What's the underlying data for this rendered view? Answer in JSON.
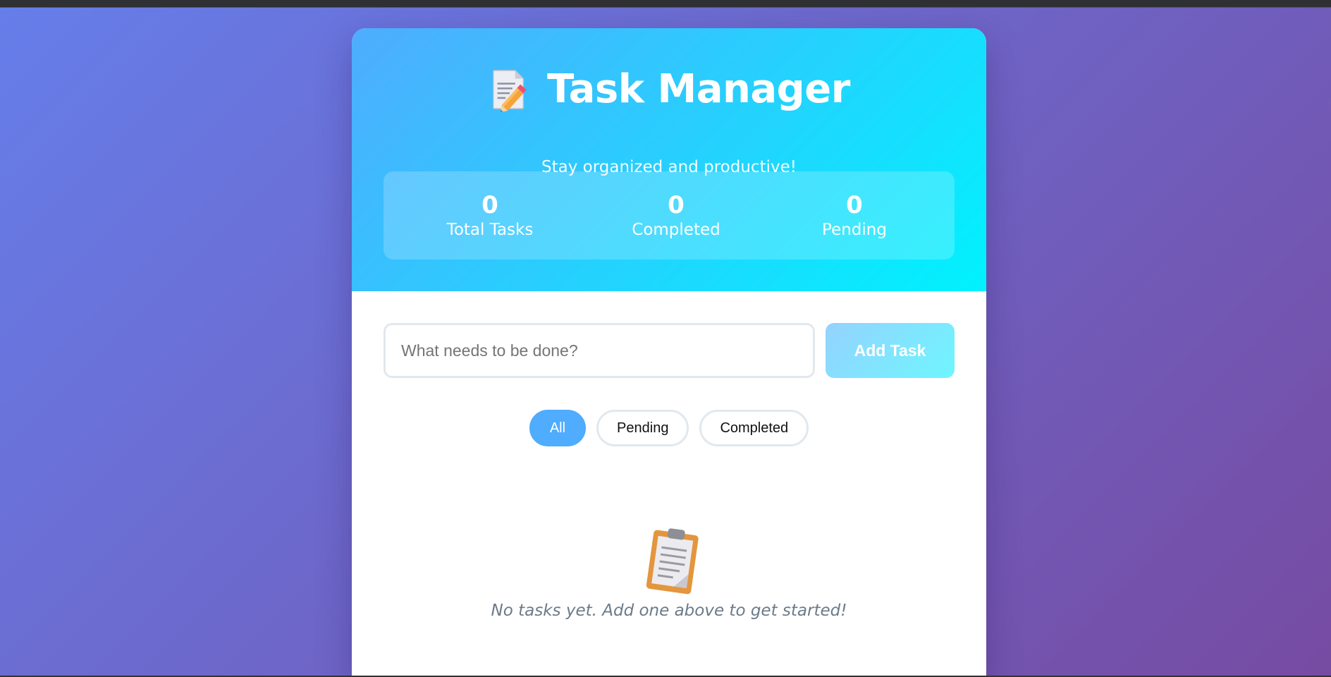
{
  "app": {
    "title": "Task Manager",
    "subtitle": "Stay organized and productive!",
    "title_icon": "memo-icon"
  },
  "stats": [
    {
      "value": "0",
      "label": "Total Tasks"
    },
    {
      "value": "0",
      "label": "Completed"
    },
    {
      "value": "0",
      "label": "Pending"
    }
  ],
  "input": {
    "placeholder": "What needs to be done?",
    "value": ""
  },
  "add_button": {
    "label": "Add Task"
  },
  "filters": [
    {
      "label": "All",
      "active": true
    },
    {
      "label": "Pending",
      "active": false
    },
    {
      "label": "Completed",
      "active": false
    }
  ],
  "empty_state": {
    "icon": "clipboard-icon",
    "message": "No tasks yet. Add one above to get started!"
  },
  "colors": {
    "page_gradient_start": "#667eea",
    "page_gradient_end": "#764ba2",
    "header_gradient_start": "#4facfe",
    "header_gradient_end": "#00f2fe",
    "accent": "#4facfe"
  }
}
